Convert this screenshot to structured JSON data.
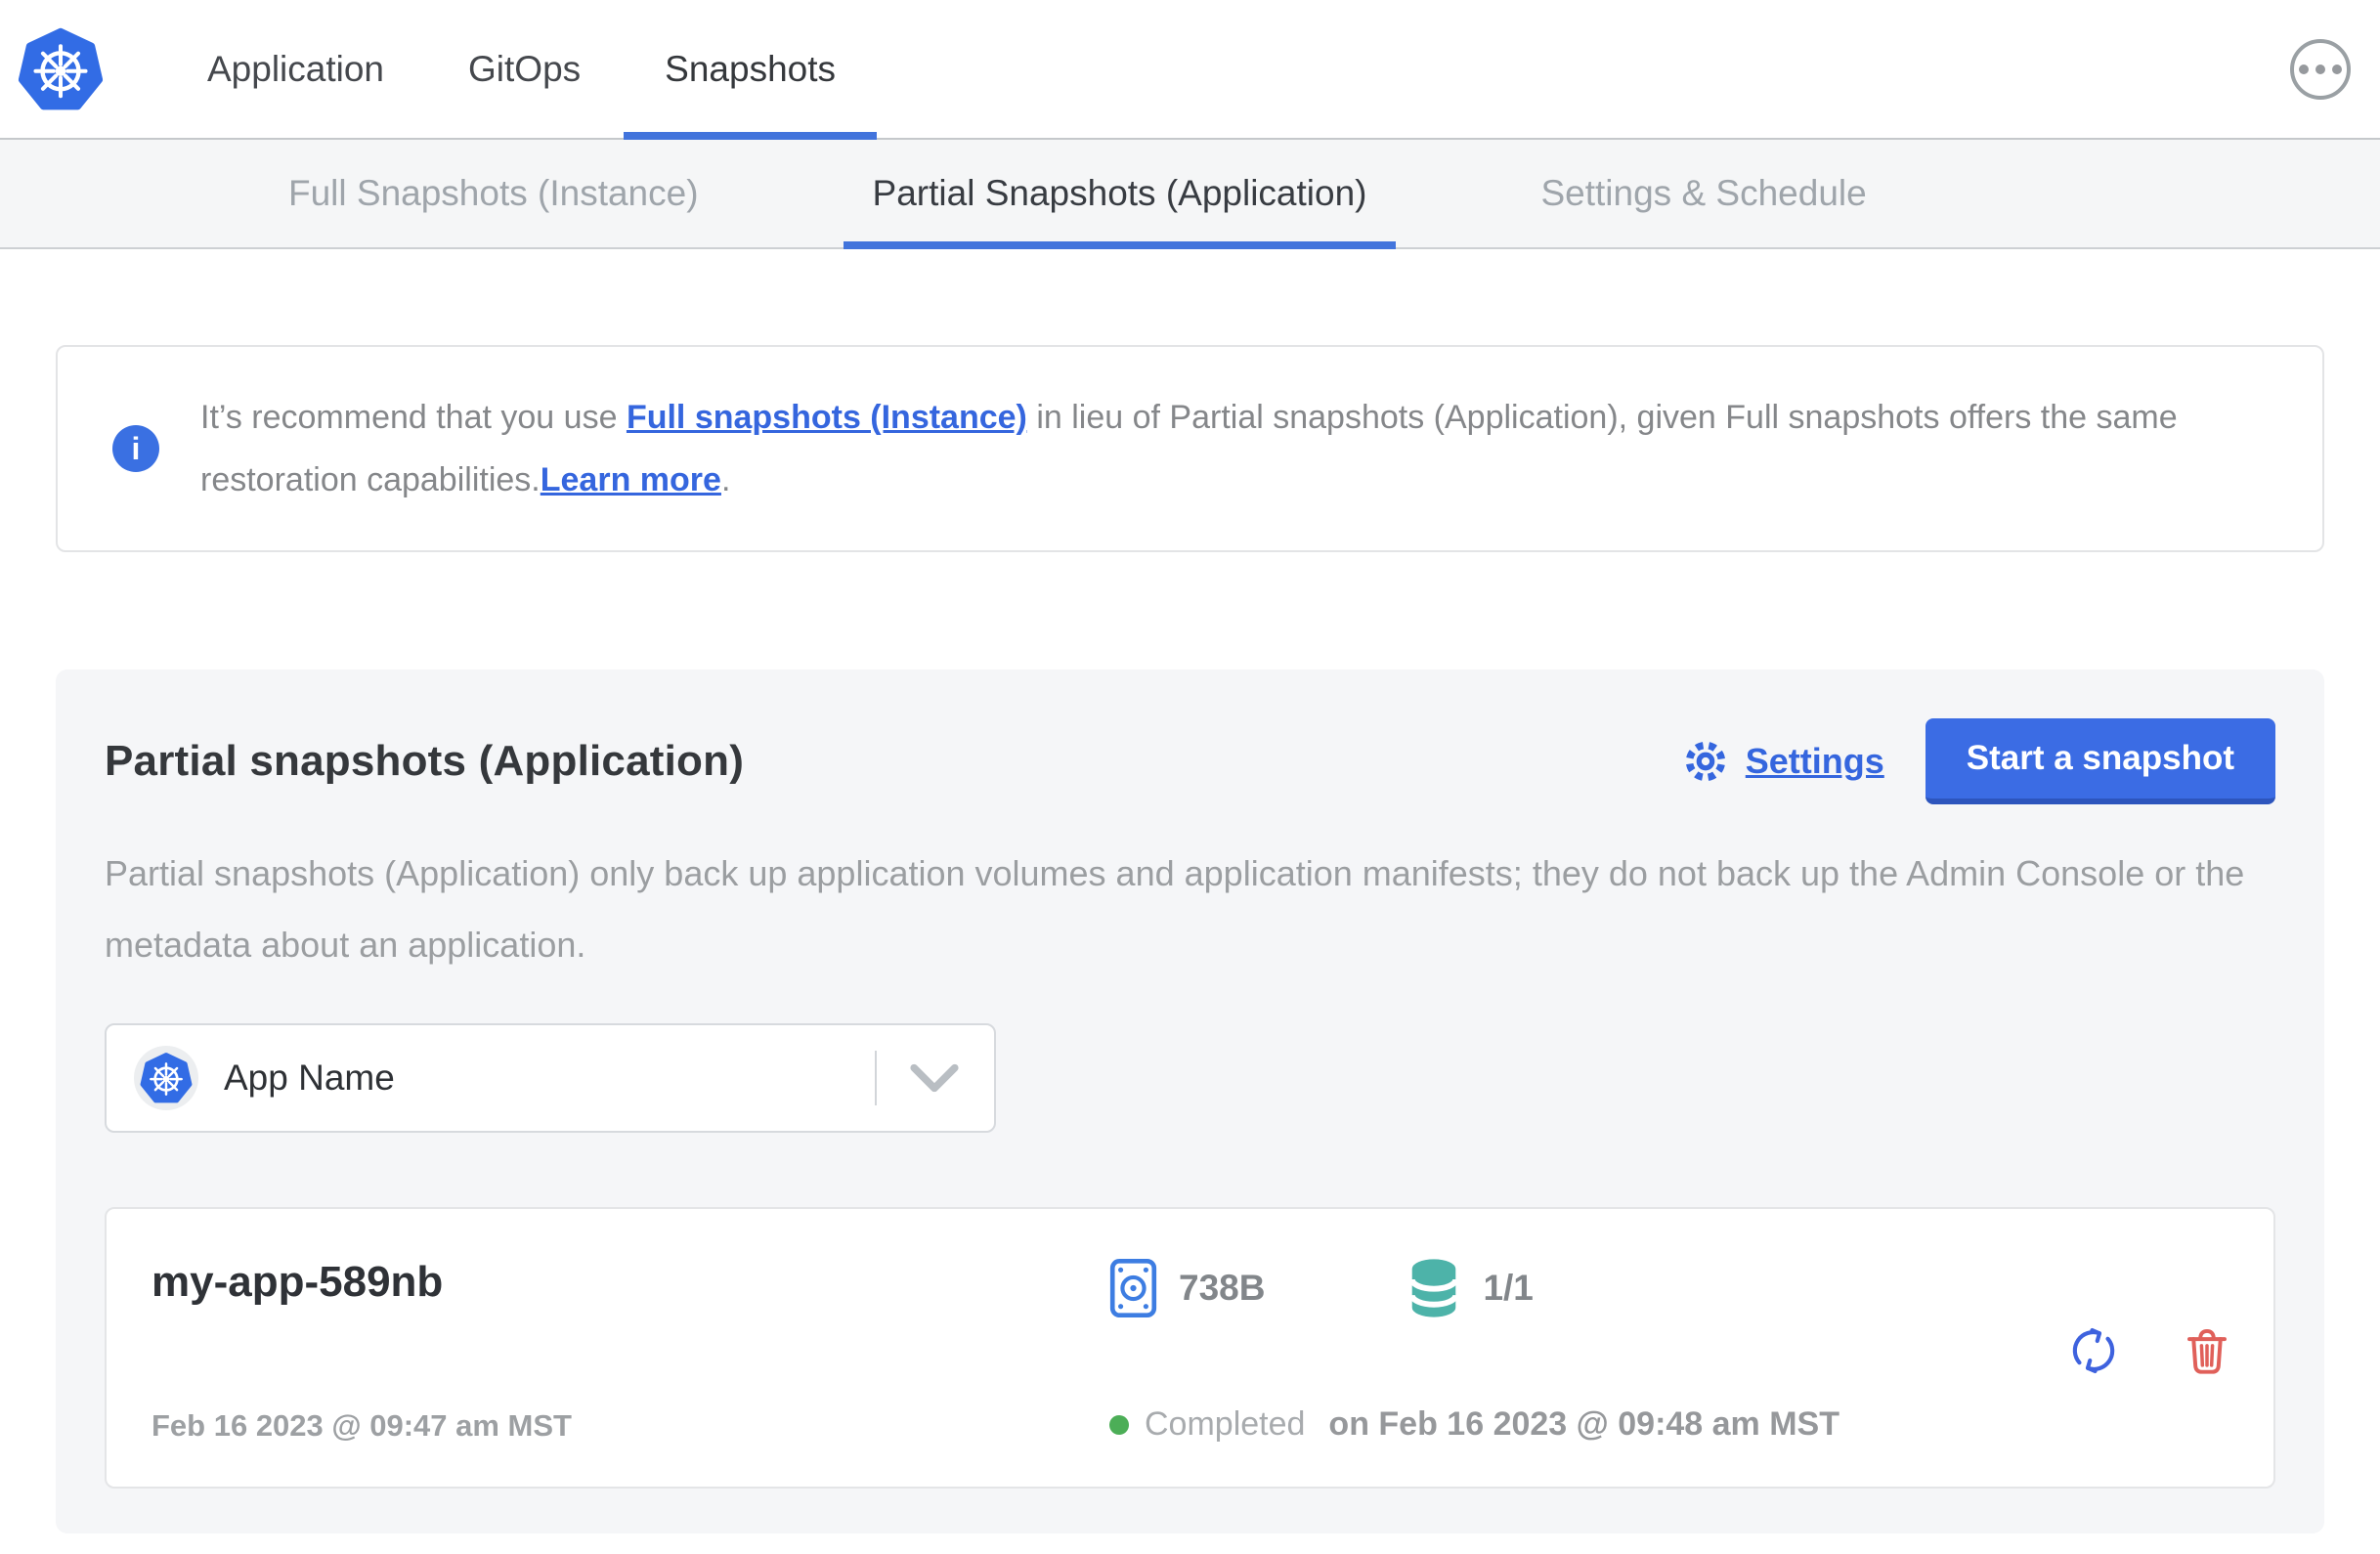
{
  "header": {
    "nav": [
      {
        "label": "Application",
        "active": false
      },
      {
        "label": "GitOps",
        "active": false
      },
      {
        "label": "Snapshots",
        "active": true
      }
    ],
    "more_menu_icon": "ellipsis-circle"
  },
  "subtabs": [
    {
      "label": "Full Snapshots (Instance)",
      "active": false
    },
    {
      "label": "Partial Snapshots (Application)",
      "active": true
    },
    {
      "label": "Settings & Schedule",
      "active": false
    }
  ],
  "info_banner": {
    "icon": "info-icon",
    "info_glyph": "i",
    "text_before": "It’s recommend that you use ",
    "link1": "Full snapshots (Instance)",
    "text_middle": " in lieu of Partial snapshots (Application), given Full snapshots offers the same restoration capabilities.",
    "link2": "Learn more",
    "text_after": "."
  },
  "main": {
    "title": "Partial snapshots (Application)",
    "settings_label": "Settings",
    "start_button": "Start a snapshot",
    "description": "Partial snapshots (Application) only back up application volumes and application manifests; they do not back up the Admin Console or the metadata about an application.",
    "app_selector": {
      "value": "App Name",
      "icon": "kubernetes-logo"
    },
    "snapshots": [
      {
        "name": "my-app-589nb",
        "started": "Feb 16 2023 @ 09:47 am MST",
        "size": "738B",
        "volumes": "1/1",
        "status": "Completed",
        "status_detail": "on Feb 16 2023 @ 09:48 am MST"
      }
    ]
  },
  "icons": [
    "kubernetes-logo",
    "ellipsis-circle",
    "info-icon",
    "gear-icon",
    "chevron-down-icon",
    "disk-icon",
    "database-icon",
    "status-dot",
    "restore-icon",
    "trash-icon"
  ],
  "colors": {
    "kubernetes_blue": "#326ce5",
    "accent_blue": "#3b6ce4",
    "button_edge_blue": "#2d55bd",
    "link_blue": "#3566de",
    "tab_underline_blue": "#4274dc",
    "teal": "#4db3a9",
    "status_green": "#4cae57",
    "delete_red": "#e0605a",
    "panel_gray": "#f5f6f8",
    "subtab_gray": "#f5f6f7"
  }
}
